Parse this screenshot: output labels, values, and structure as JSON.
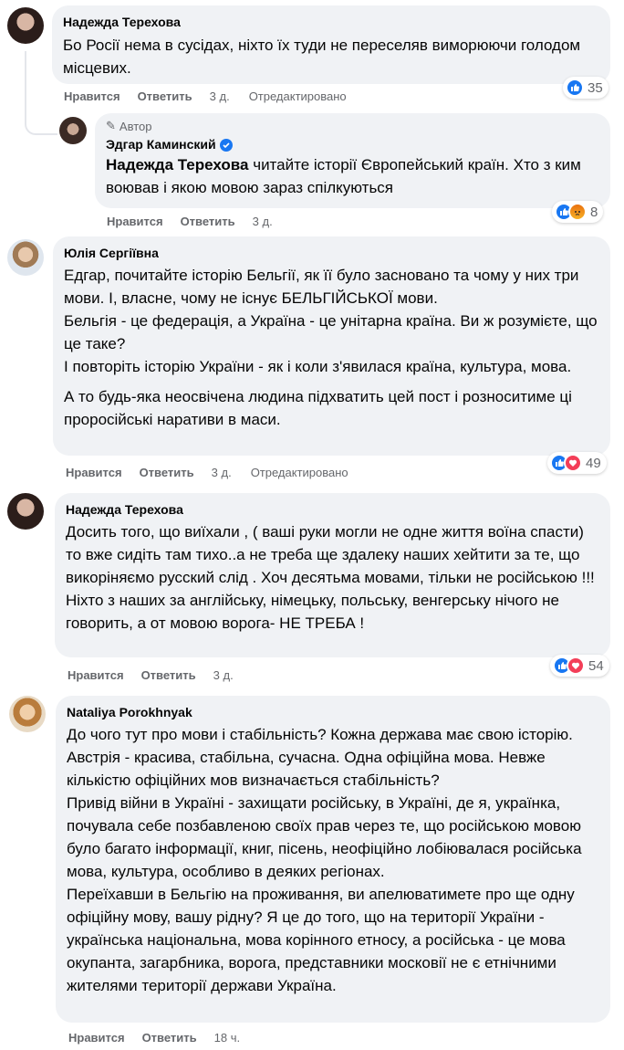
{
  "colors": {
    "bubble": "#f0f2f5",
    "meta": "#65676b",
    "like": "#1877f2",
    "love": "#f33e58",
    "angry": "#f7b125"
  },
  "actions": {
    "like": "Нравится",
    "reply": "Ответить"
  },
  "comments": [
    {
      "author": "Надежда Терехова",
      "text": "Бо Росії нема в сусідах, ніхто їх туди не переселяв виморюючи голодом місцевих.",
      "time": "3 д.",
      "edited": "Отредактировано",
      "reaction_icons": [
        "like-icon"
      ],
      "reaction_count": "35"
    },
    {
      "badge": "Автор",
      "author": "Эдгар Каминский",
      "mention": "Надежда Терехова",
      "text": " читайте історії Європейський країн. Хто з ким воював і якою мовою зараз спілкуються",
      "time": "3 д.",
      "reaction_icons": [
        "like-icon",
        "angry-icon"
      ],
      "reaction_count": "8"
    },
    {
      "author": "Юлія Сергіївна",
      "text": "Едгар, почитайте історію Бельгії, як її було засновано та чому у них три мови. І, власне, чому не існує БЕЛЬГІЙСЬКОЇ мови.\nБельгія - це федерація, а Україна - це унітарна країна. Ви ж розумієте, що це таке?\nІ повторіть історію України - як і коли з'явилася країна, культура, мова.",
      "text2": "А то будь-яка неосвічена людина підхватить цей пост і розноситиме ці проросійські наративи в маси.",
      "time": "3 д.",
      "edited": "Отредактировано",
      "reaction_icons": [
        "like-icon",
        "love-icon"
      ],
      "reaction_count": "49"
    },
    {
      "author": "Надежда Терехова",
      "text": "Досить того, що виїхали , ( ваші руки могли не одне життя воїна спасти) то вже сидіть там тихо..а не треба ще здалеку наших хейтити за те, що викоріняємо русский слід . Хоч десятьма мовами, тільки не російською !!! Ніхто з наших за англійську, німецьку, польську, венгерську нічого не говорить, а от мовою ворога- НЕ ТРЕБА !",
      "time": "3 д.",
      "reaction_icons": [
        "like-icon",
        "love-icon"
      ],
      "reaction_count": "54"
    },
    {
      "author": "Nataliya Porokhnyak",
      "text": "До чого тут про мови і стабільність? Кожна держава має свою історію. Австрія - красива, стабільна, сучасна. Одна офіційна мова. Невже кількістю офіційних мов визначається стабільність?\nПривід війни в Україні - захищати російську, в Україні, де я, українка, почувала себе позбавленою своїх прав через те, що російською мовою було багато інформації, книг, пісень, неофіційно лобіювалася російська мова, культура, особливо в деяких регіонах.\nПереїхавши в Бельгію на проживання, ви апелюватимете про ще одну офіційну мову, вашу рідну? Я це до того, що на території України - українська національна, мова корінного етносу, а російська - це мова окупанта, загарбника, ворога, представники московії не є етнічними жителями території держави Україна.",
      "time": "18 ч."
    }
  ]
}
